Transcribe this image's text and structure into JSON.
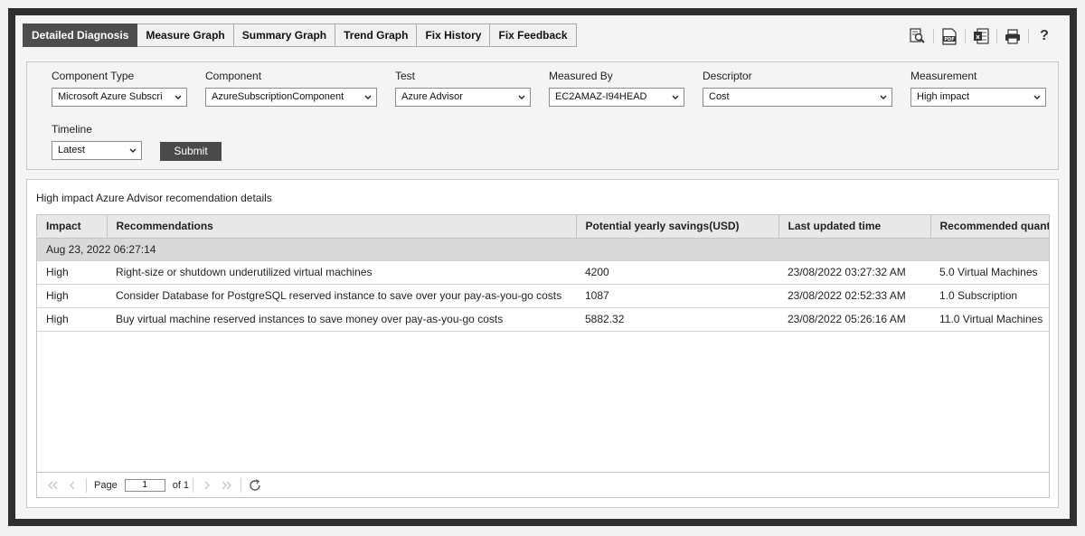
{
  "tabs": [
    {
      "label": "Detailed Diagnosis",
      "active": true
    },
    {
      "label": "Measure Graph",
      "active": false
    },
    {
      "label": "Summary Graph",
      "active": false
    },
    {
      "label": "Trend Graph",
      "active": false
    },
    {
      "label": "Fix History",
      "active": false
    },
    {
      "label": "Fix Feedback",
      "active": false
    }
  ],
  "toolbar_icons": [
    "zoom-report-icon",
    "pdf-icon",
    "excel-icon",
    "print-icon",
    "help-icon"
  ],
  "filters": {
    "component_type": {
      "label": "Component Type",
      "value": "Microsoft Azure Subscri"
    },
    "component": {
      "label": "Component",
      "value": "AzureSubscriptionComponent"
    },
    "test": {
      "label": "Test",
      "value": "Azure Advisor"
    },
    "measured_by": {
      "label": "Measured By",
      "value": "EC2AMAZ-I94HEAD"
    },
    "descriptor": {
      "label": "Descriptor",
      "value": "Cost"
    },
    "measurement": {
      "label": "Measurement",
      "value": "High impact"
    },
    "timeline": {
      "label": "Timeline",
      "value": "Latest"
    },
    "submit_label": "Submit"
  },
  "results": {
    "title": "High impact Azure Advisor recomendation details",
    "columns": [
      "Impact",
      "Recommendations",
      "Potential yearly savings(USD)",
      "Last updated time",
      "Recommended quantit"
    ],
    "group_label": "Aug 23, 2022 06:27:14",
    "rows": [
      [
        "High",
        "Right-size or shutdown underutilized virtual machines",
        "4200",
        "23/08/2022 03:27:32 AM",
        "5.0 Virtual Machines"
      ],
      [
        "High",
        "Consider Database for PostgreSQL reserved instance to save over your pay-as-you-go costs",
        "1087",
        "23/08/2022 02:52:33 AM",
        "1.0 Subscription"
      ],
      [
        "High",
        "Buy virtual machine reserved instances to save money over pay-as-you-go costs",
        "5882.32",
        "23/08/2022 05:26:16 AM",
        "11.0 Virtual Machines"
      ]
    ]
  },
  "pager": {
    "page_label": "Page",
    "page_value": "1",
    "of_label": "of 1"
  }
}
